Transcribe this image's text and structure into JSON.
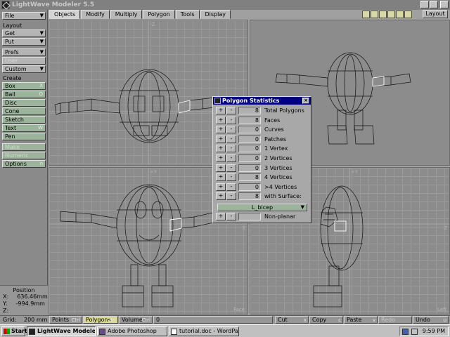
{
  "window": {
    "title": "LightWave Modeler 5.5",
    "buttons": [
      "_",
      "□",
      "×"
    ]
  },
  "sidebar": {
    "file": "File",
    "layout_head": "Layout",
    "get": "Get",
    "put": "Put",
    "prefs": "Prefs",
    "user": "User",
    "custom": "Custom",
    "create_head": "Create",
    "box": "Box",
    "box_sc": "X",
    "ball": "Ball",
    "ball_sc": "O",
    "disc": "Disc",
    "cone": "Cone",
    "sketch": "Sketch",
    "text": "Text",
    "text_sc": "W",
    "pen": "Pen",
    "make": "Make",
    "numeric": "Numeric",
    "options": "Options",
    "options_sc": "n",
    "position": {
      "title": "Position",
      "x_label": "X:",
      "x_value": "636.46mm",
      "y_label": "Y:",
      "y_value": "-994.9mm",
      "z_label": "Z:"
    }
  },
  "tabs": [
    "Objects",
    "Modify",
    "Multiply",
    "Polygon",
    "Tools",
    "Display"
  ],
  "toolbar": {
    "layout": "Layout"
  },
  "viewports": {
    "top_left": {
      "axis_v": "-Z",
      "axis_h": "X"
    },
    "bottom_left": {
      "axis_v": "+Y",
      "axis_h": "X",
      "label": "Face"
    },
    "bottom_right": {
      "axis_v": "+Y",
      "axis_h": "Z",
      "label": "Left"
    }
  },
  "dialog": {
    "title": "Polygon Statistics",
    "plus": "+",
    "minus": "-",
    "rows": [
      {
        "count": "8",
        "label": "Total Polygons"
      },
      {
        "count": "8",
        "label": "Faces"
      },
      {
        "count": "0",
        "label": "Curves"
      },
      {
        "count": "0",
        "label": "Patches"
      },
      {
        "count": "0",
        "label": "1 Vertex"
      },
      {
        "count": "0",
        "label": "2 Vertices"
      },
      {
        "count": "0",
        "label": "3 Vertices"
      },
      {
        "count": "8",
        "label": "4 Vertices"
      },
      {
        "count": "0",
        "label": ">4 Vertices"
      },
      {
        "count": "8",
        "label": "with Surface:"
      }
    ],
    "surface": "L_bicep",
    "nonplanar": {
      "count": "",
      "label": "Non-planar"
    }
  },
  "bottombar": {
    "grid_label": "Grid:",
    "grid_value": "200 mm",
    "points": "Points",
    "points_sc": "Ctrl",
    "polygons": "Polygons",
    "polygons_sc": "Ctrl",
    "volume": "Volume",
    "volume_sc": "Ctrl",
    "count": "0",
    "cut": "Cut",
    "cut_sc": "x",
    "copy": "Copy",
    "copy_sc": "c",
    "paste": "Paste",
    "paste_sc": "v",
    "redo": "Redo",
    "undo": "Undo",
    "undo_sc": "u"
  },
  "taskbar": {
    "start": "Start",
    "tasks": [
      "LightWave Modeler 5.5",
      "Adobe Photoshop",
      "tutorial.doc - WordPad"
    ],
    "time": "9:59 PM"
  }
}
